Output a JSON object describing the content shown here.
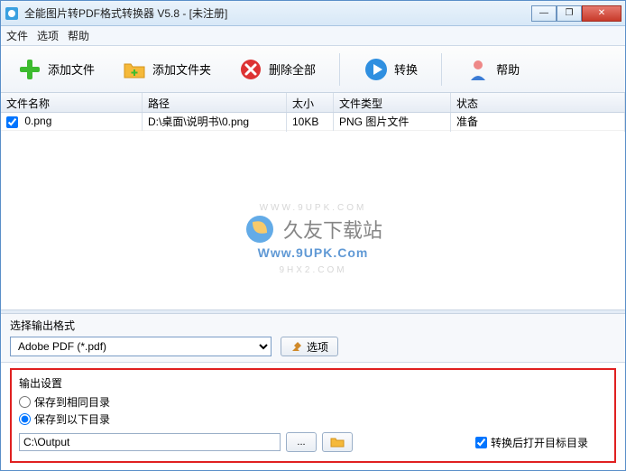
{
  "titlebar": {
    "text": "全能图片转PDF格式转换器 V5.8 -  [未注册]"
  },
  "winbtns": {
    "min": "—",
    "max": "❐",
    "close": "✕"
  },
  "menu": {
    "file": "文件",
    "options": "选项",
    "help": "帮助"
  },
  "toolbar": {
    "add_file": "添加文件",
    "add_folder": "添加文件夹",
    "delete_all": "删除全部",
    "convert": "转换",
    "help": "帮助"
  },
  "columns": {
    "name": "文件名称",
    "path": "路径",
    "size": "太小",
    "type": "文件类型",
    "status": "状态"
  },
  "rows": [
    {
      "checked": true,
      "name": "0.png",
      "path": "D:\\桌面\\说明书\\0.png",
      "size": "10KB",
      "type": "PNG 图片文件",
      "status": "准备"
    }
  ],
  "watermark": {
    "site": "久友下载站",
    "url": "Www.9UPK.Com",
    "tiny": "WWW.9UPK.COM",
    "pinyin": "9HX2.COM"
  },
  "format": {
    "label": "选择输出格式",
    "selected": "Adobe PDF (*.pdf)",
    "options_btn": "选项"
  },
  "output": {
    "group_title": "输出设置",
    "radio_same": "保存到相同目录",
    "radio_below": "保存到以下目录",
    "selected_radio": "below",
    "path": "C:\\Output",
    "browse": "...",
    "open_after": "转换后打开目标目录",
    "open_after_checked": true
  }
}
